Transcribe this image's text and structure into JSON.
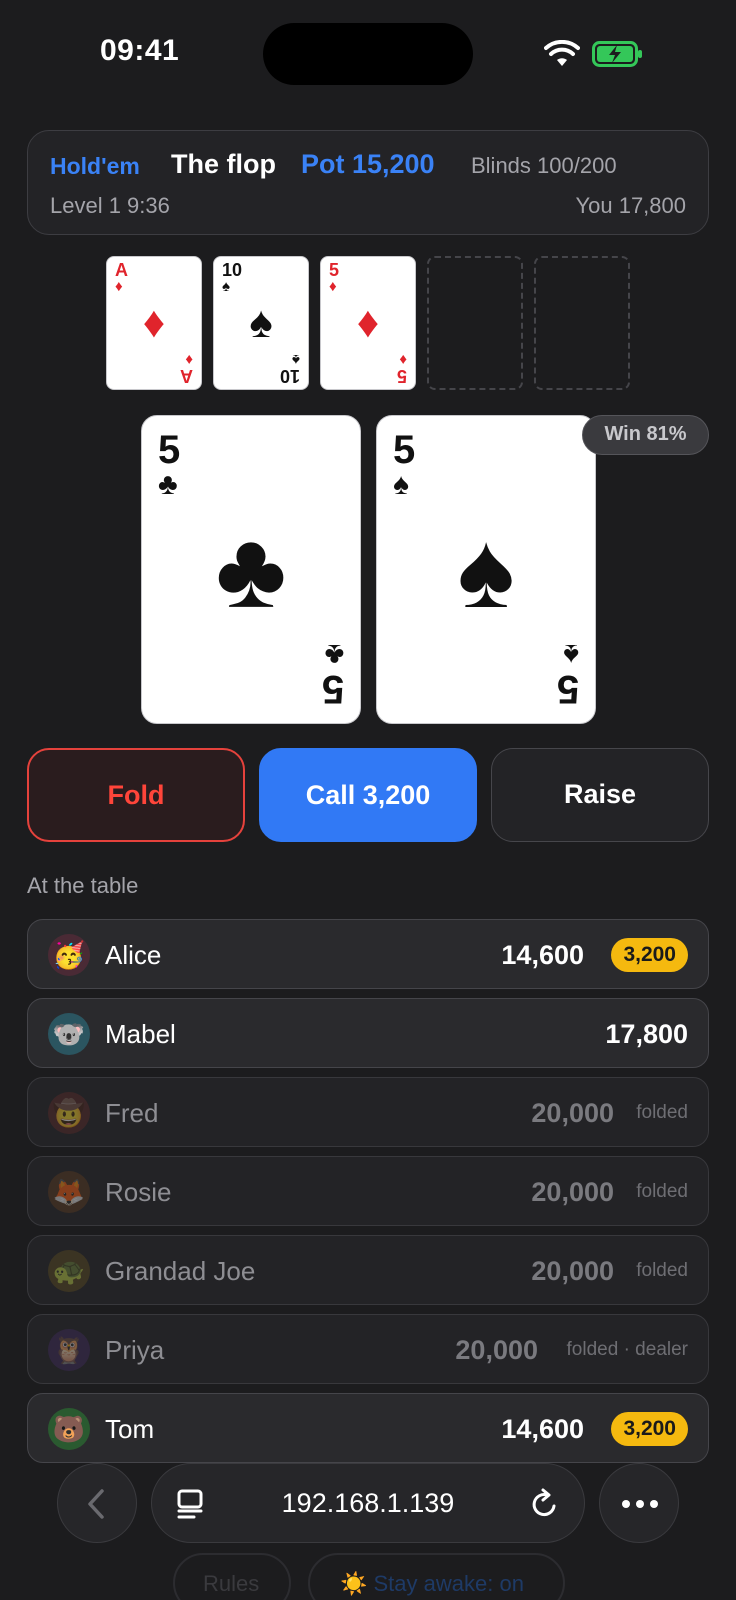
{
  "status": {
    "time": "09:41",
    "wifi_icon": "wifi-icon",
    "battery_icon": "battery-charging-icon"
  },
  "header": {
    "game": "Hold'em",
    "street": "The flop",
    "pot": "Pot 15,200",
    "blinds": "Blinds 100/200",
    "level": "Level 1 9:36",
    "your_stack": "You 17,800"
  },
  "board": [
    {
      "rank": "A",
      "suit": "♦",
      "color": "red"
    },
    {
      "rank": "10",
      "suit": "♠",
      "color": "black"
    },
    {
      "rank": "5",
      "suit": "♦",
      "color": "red"
    }
  ],
  "hole": [
    {
      "rank": "5",
      "suit": "♣"
    },
    {
      "rank": "5",
      "suit": "♠"
    }
  ],
  "win_badge": "Win 81%",
  "actions": {
    "fold": "Fold",
    "call": "Call 3,200",
    "raise": "Raise"
  },
  "table_label": "At the table",
  "players": [
    {
      "avatar": "🥳",
      "name": "Alice",
      "stack": "14,600",
      "bet": "3,200",
      "note": "",
      "folded": false
    },
    {
      "avatar": "🐨",
      "name": "Mabel",
      "stack": "17,800",
      "bet": "",
      "note": "",
      "folded": false
    },
    {
      "avatar": "🤠",
      "name": "Fred",
      "stack": "20,000",
      "bet": "",
      "note": "folded",
      "folded": true
    },
    {
      "avatar": "🦊",
      "name": "Rosie",
      "stack": "20,000",
      "bet": "",
      "note": "folded",
      "folded": true
    },
    {
      "avatar": "🐢",
      "name": "Grandad Joe",
      "stack": "20,000",
      "bet": "",
      "note": "folded",
      "folded": true
    },
    {
      "avatar": "🦉",
      "name": "Priya",
      "stack": "20,000",
      "bet": "",
      "note": "folded · dealer",
      "folded": true
    },
    {
      "avatar": "🐻",
      "name": "Tom",
      "stack": "14,600",
      "bet": "3,200",
      "note": "",
      "folded": false
    }
  ],
  "behind": {
    "rules": "Rules",
    "stay_awake": "☀️ Stay awake: on"
  },
  "browser": {
    "url": "192.168.1.139",
    "back_icon": "chevron-left-icon",
    "tabs_icon": "reader-icon",
    "reload_icon": "reload-icon",
    "more_icon": "more-icon"
  },
  "colors": {
    "accent": "#3179f5",
    "fold": "#ff453a",
    "bet_chip": "#f5b90f",
    "background": "#1c1c1e"
  }
}
